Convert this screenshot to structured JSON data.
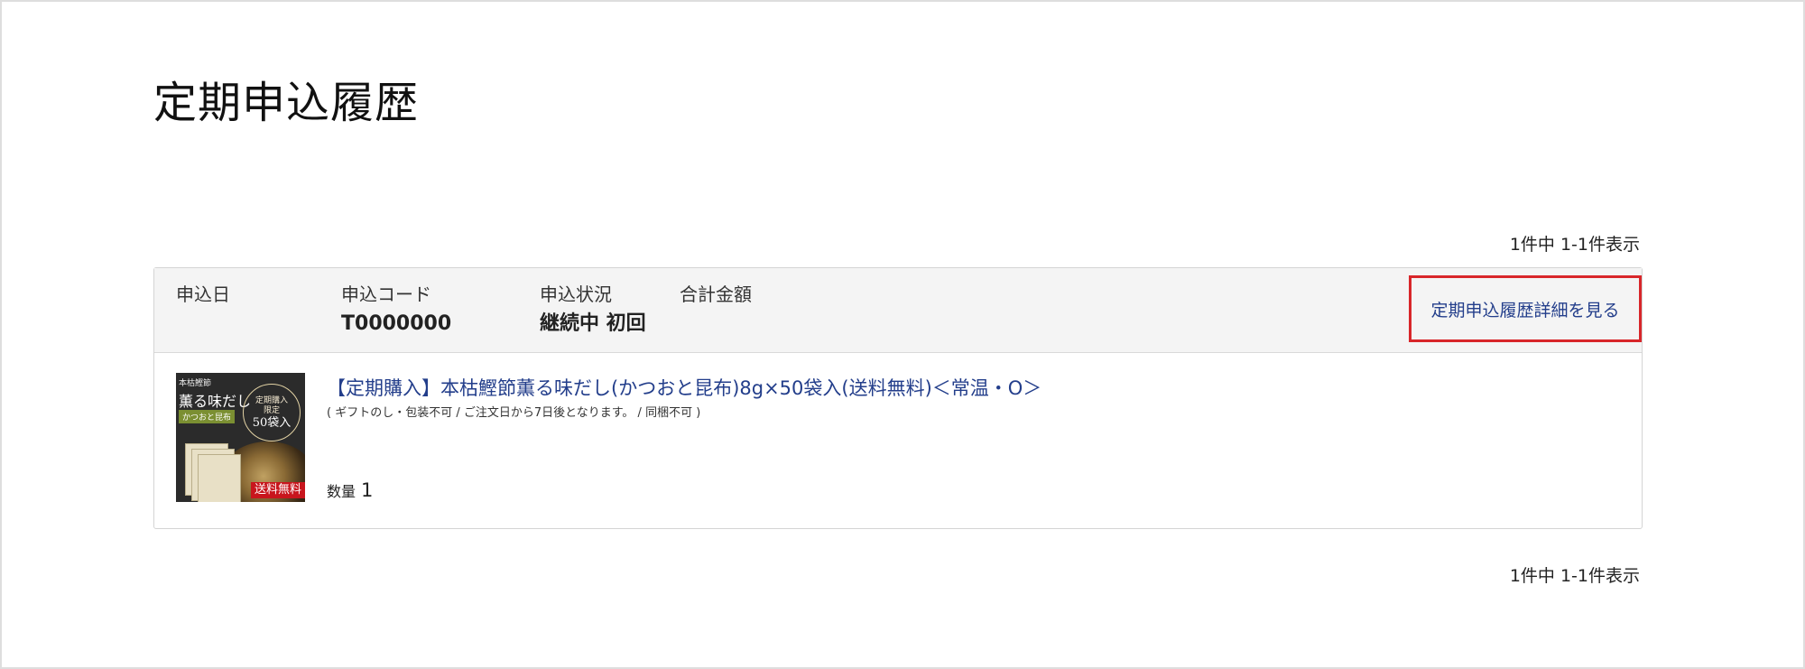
{
  "page": {
    "title": "定期申込履歴",
    "count_top": "1件中 1-1件表示",
    "count_bottom": "1件中 1-1件表示"
  },
  "order": {
    "date_label": "申込日",
    "date_value": "",
    "code_label": "申込コード",
    "code_value": "T0000000",
    "status_label": "申込状況",
    "status_value": "継続中 初回",
    "total_label": "合計金額",
    "total_value": "",
    "detail_link": "定期申込履歴詳細を見る",
    "item": {
      "name": "【定期購入】本枯鰹節薫る味だし(かつおと昆布)8g×50袋入(送料無料)＜常温・O＞",
      "note": "( ギフトのし・包装不可 / ご注文日から7日後となります。 / 同梱不可 )",
      "quantity_label": "数量",
      "quantity_value": "1",
      "thumbnail": {
        "brand": "本枯鰹節",
        "name": "薫る味だし",
        "sub": "かつおと昆布",
        "badge_line1": "定期購入",
        "badge_line2": "限定",
        "badge_line3": "50袋入",
        "ribbon": "送料無料"
      }
    }
  },
  "colors": {
    "link": "#233e8b",
    "highlight_border": "#d8262a",
    "header_bg": "#f4f4f4"
  }
}
